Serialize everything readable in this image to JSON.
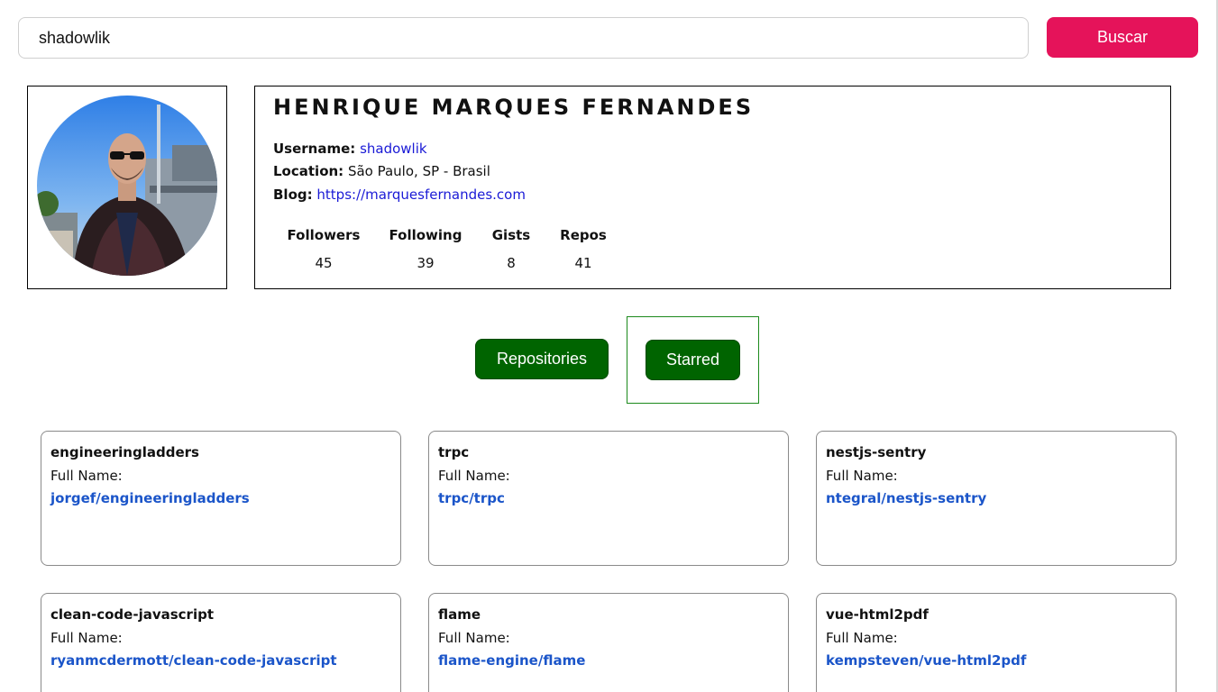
{
  "search": {
    "value": "shadowlik",
    "button_label": "Buscar"
  },
  "profile": {
    "name": "HENRIQUE MARQUES FERNANDES",
    "username_label": "Username:",
    "username": "shadowlik",
    "location_label": "Location:",
    "location": "São Paulo, SP - Brasil",
    "blog_label": "Blog:",
    "blog": "https://marquesfernandes.com",
    "stats": [
      {
        "label": "Followers",
        "value": "45"
      },
      {
        "label": "Following",
        "value": "39"
      },
      {
        "label": "Gists",
        "value": "8"
      },
      {
        "label": "Repos",
        "value": "41"
      }
    ]
  },
  "tabs": {
    "repositories": "Repositories",
    "starred": "Starred",
    "active": "starred"
  },
  "repos": [
    {
      "name": "engineeringladders",
      "fullname_label": "Full Name:",
      "fullname": "jorgef/engineeringladders"
    },
    {
      "name": "trpc",
      "fullname_label": "Full Name:",
      "fullname": "trpc/trpc"
    },
    {
      "name": "nestjs-sentry",
      "fullname_label": "Full Name:",
      "fullname": "ntegral/nestjs-sentry"
    },
    {
      "name": "clean-code-javascript",
      "fullname_label": "Full Name:",
      "fullname": "ryanmcdermott/clean-code-javascript"
    },
    {
      "name": "flame",
      "fullname_label": "Full Name:",
      "fullname": "flame-engine/flame"
    },
    {
      "name": "vue-html2pdf",
      "fullname_label": "Full Name:",
      "fullname": "kempsteven/vue-html2pdf"
    }
  ],
  "colors": {
    "search_button": "#e5135a",
    "tab_button": "#006400",
    "link": "#1b55c9"
  }
}
